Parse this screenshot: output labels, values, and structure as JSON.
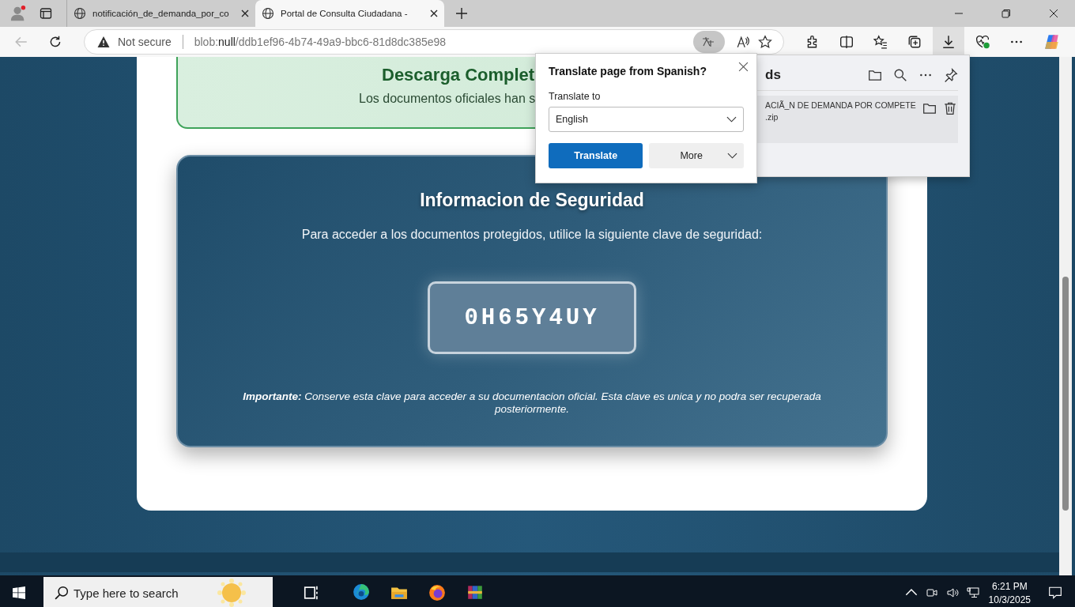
{
  "browser": {
    "tabs": [
      {
        "title": "notificación_de_demanda_por_co",
        "selected": false
      },
      {
        "title": "Portal de Consulta Ciudadana - ",
        "selected": true
      }
    ],
    "address": {
      "security": "Not secure",
      "url": "blob:**null**/ddb1ef96-4b74-49a9-bbc6-81d8dc385e98"
    },
    "downloads_panel": {
      "title": "ds",
      "file_name": "ACIÃ_N DE DEMANDA POR COMPETE",
      "file_ext": ".zip"
    },
    "translate_popup": {
      "title": "Translate page from Spanish?",
      "label": "Translate to",
      "language": "English",
      "primary_button": "Translate",
      "secondary_button": "More"
    }
  },
  "page": {
    "notice": {
      "title": "Descarga Complet",
      "text": "Los documentos oficiales han s"
    },
    "security": {
      "title": "Informacion de Seguridad",
      "text": "Para acceder a los documentos protegidos, utilice la siguiente clave de seguridad:",
      "key": "0H65Y4UY",
      "note": "**Importante:** Conserve esta clave para acceder a su documentacion oficial. Esta clave es unica y no podra ser recuperada posteriormente."
    }
  },
  "taskbar": {
    "search_placeholder": "Type here to search",
    "time": "6:21 PM",
    "date": "10/3/2025"
  }
}
